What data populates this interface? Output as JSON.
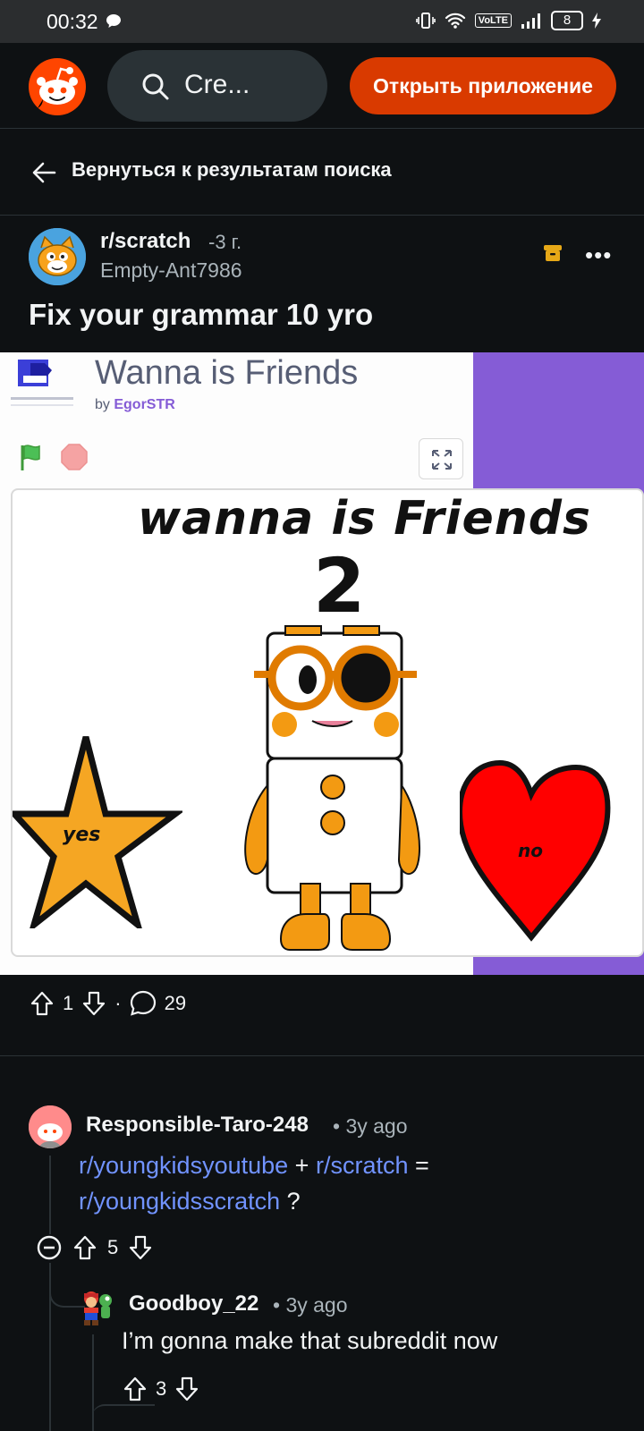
{
  "status_bar": {
    "time": "00:32",
    "network_badge": "VoLTE",
    "battery": "8"
  },
  "header": {
    "search_text": "Cre...",
    "open_app_label": "Открыть приложение"
  },
  "back_link": "Вернуться к результатам поиска",
  "post": {
    "subreddit": "r/scratch",
    "age": "-3 г.",
    "author": "Empty-Ant7986",
    "title": "Fix your grammar 10 yro",
    "upvotes": "1",
    "comments": "29",
    "dot": "·"
  },
  "media": {
    "project_title": "Wanna is Friends",
    "project_by": "by",
    "project_author": "EgorSTR",
    "stage_title": "wanna is Friends",
    "stage_number": "2",
    "star_label": "yes",
    "heart_label": "no"
  },
  "comments": [
    {
      "author": "Responsible-Taro-248",
      "time": "• 3y ago",
      "link1": "r/youngkidsyoutube",
      "plus": "+",
      "link2": "r/scratch",
      "equals": "=",
      "link3": "r/youngkidsscratch",
      "question": "?",
      "votes": "5"
    },
    {
      "author": "Goodboy_22",
      "time": "• 3y ago",
      "body": "I’m gonna make that subreddit now",
      "votes": "3"
    }
  ],
  "colors": {
    "background": "#0e1113",
    "accent": "#d93a00",
    "link": "#7193ff",
    "scratch_purple": "#855cd6"
  }
}
